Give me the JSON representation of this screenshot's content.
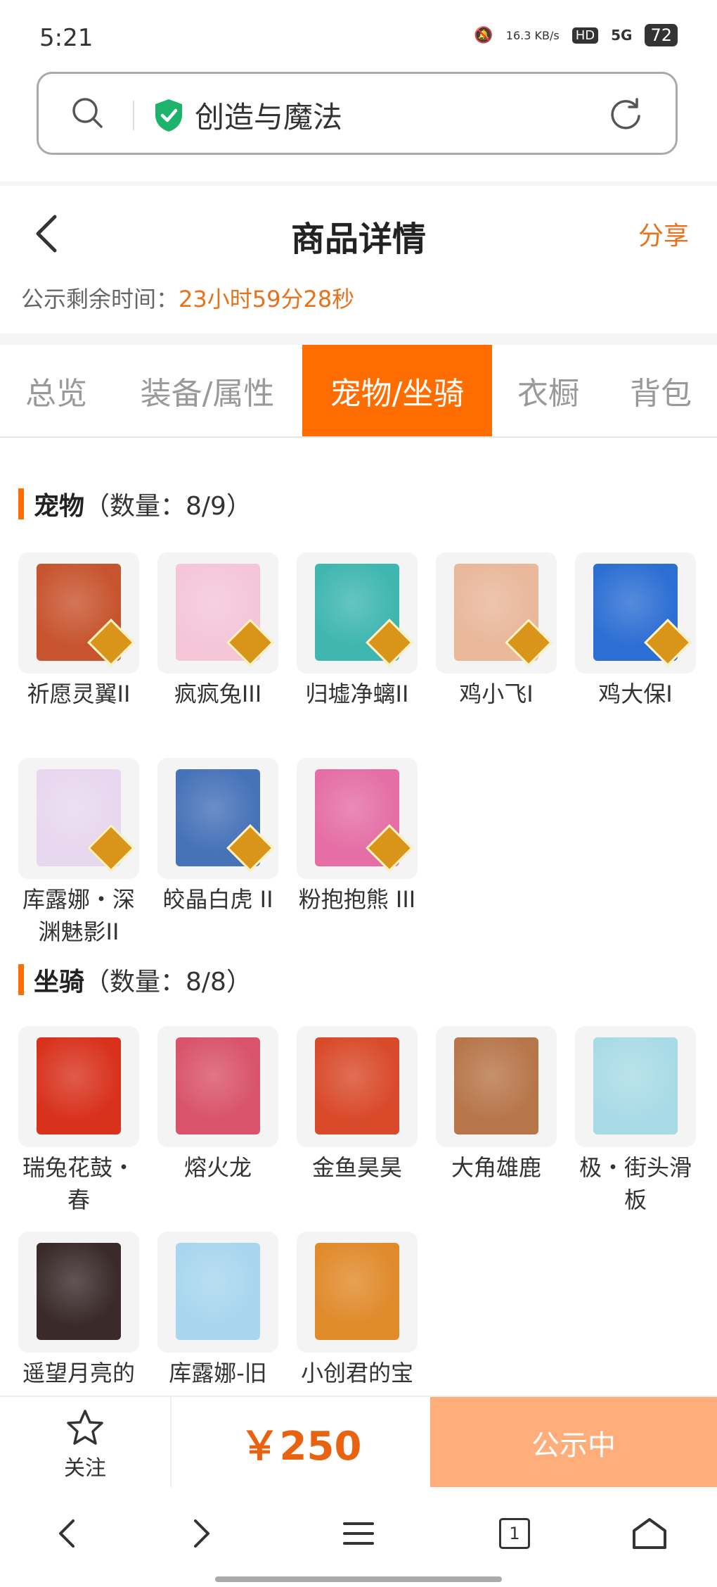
{
  "status_bar": {
    "time": "5:21",
    "net_speed": "16.3 KB/s",
    "hd": "HD",
    "signal": "5G",
    "battery": "72"
  },
  "browser": {
    "site_name": "创造与魔法"
  },
  "header": {
    "title": "商品详情",
    "share": "分享",
    "timer_label": "公示剩余时间：",
    "timer_value": "23小时59分28秒"
  },
  "tabs": [
    {
      "label": "总览"
    },
    {
      "label": "装备/属性"
    },
    {
      "label": "宠物/坐骑",
      "active": true
    },
    {
      "label": "衣橱"
    },
    {
      "label": "背包"
    }
  ],
  "pets": {
    "title": "宠物",
    "count": "（数量：8/9）",
    "items": [
      {
        "name": "祈愿灵翼II",
        "color": "#c7542e"
      },
      {
        "name": "疯疯兔III",
        "color": "#f4c6d8"
      },
      {
        "name": "归墟净螭II",
        "color": "#3fb6b0"
      },
      {
        "name": "鸡小飞I",
        "color": "#e9b79a"
      },
      {
        "name": "鸡大保I",
        "color": "#2c6ed3"
      },
      {
        "name": "库露娜・深渊魅影II",
        "color": "#e7d7ef"
      },
      {
        "name": "皎晶白虎 II",
        "color": "#4672b8"
      },
      {
        "name": "粉抱抱熊 III",
        "color": "#e46ea5"
      }
    ]
  },
  "mounts": {
    "title": "坐骑",
    "count": "（数量：8/8）",
    "items": [
      {
        "name": "瑞兔花鼓・春",
        "color": "#d8321d"
      },
      {
        "name": "熔火龙",
        "color": "#d9536a"
      },
      {
        "name": "金鱼昊昊",
        "color": "#d94a2a"
      },
      {
        "name": "大角雄鹿",
        "color": "#b7764a"
      },
      {
        "name": "极・街头滑板",
        "color": "#a9dbe6"
      },
      {
        "name": "遥望月亮的",
        "color": "#3a2a2a"
      },
      {
        "name": "库露娜-旧",
        "color": "#a8d6ee"
      },
      {
        "name": "小创君的宝",
        "color": "#e08a2a"
      }
    ]
  },
  "bottom": {
    "follow": "关注",
    "price": "￥250",
    "status": "公示中"
  },
  "nav": {
    "tab_count": "1"
  }
}
